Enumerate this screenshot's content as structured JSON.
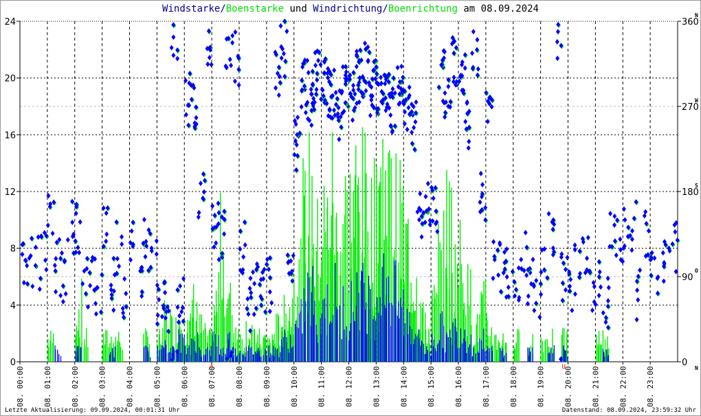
{
  "title": {
    "part1": "Windstarke/",
    "part2": "Boenstarke",
    "part3": " und ",
    "part4": "Windrichtung/",
    "part5": "Boenrichtung",
    "part6": " am 08.09.2024"
  },
  "footer": {
    "left": "Letzte Aktualisierung: 09.09.2024, 00:01:31 Uhr",
    "right": "Datenstand: 08.09.2024, 23:59:32 Uhr"
  },
  "colors": {
    "speed": "#0000ff",
    "gust": "#00ee00",
    "grid": "#000000",
    "dirgrid": "#bbbbbb",
    "marker": "#ff0000"
  },
  "chart_data": {
    "type": "line",
    "title": "Windstarke/Boenstarke und Windrichtung/Boenrichtung am 08.09.2024",
    "x_labels": [
      "08. 00:00",
      "08. 01:00",
      "08. 02:00",
      "08. 03:00",
      "08. 04:00",
      "08. 05:00",
      "08. 06:00",
      "08. 07:00",
      "08. 08:00",
      "08. 09:00",
      "08. 10:00",
      "08. 11:00",
      "08. 12:00",
      "08. 13:00",
      "08. 14:00",
      "08. 15:00",
      "08. 16:00",
      "08. 17:00",
      "08. 18:00",
      "08. 19:00",
      "08. 20:00",
      "08. 21:00",
      "08. 22:00",
      "08. 23:00"
    ],
    "left_axis": {
      "ylim": [
        0,
        24
      ],
      "ticks": [
        "0",
        "4",
        "8",
        "12",
        "16",
        "20",
        "24"
      ]
    },
    "right_axis": {
      "ylim": [
        0,
        360
      ],
      "ticks": [
        "0",
        "90",
        "180",
        "270",
        "360"
      ],
      "compass": [
        "N",
        "O",
        "S",
        "W",
        "N"
      ]
    },
    "markers": [
      {
        "hour": 7.0,
        "label": "A"
      },
      {
        "hour": 19.85,
        "label": "U"
      }
    ],
    "interval_minutes": 15,
    "series": [
      {
        "name": "Windstarke",
        "color": "#0000ff",
        "values": [
          0,
          0,
          0,
          0,
          0,
          1,
          0,
          0,
          1,
          0,
          0,
          0,
          0,
          1,
          0,
          0,
          0,
          0,
          1,
          0,
          1,
          2,
          1,
          2,
          1,
          2,
          1,
          1,
          2,
          1,
          2,
          1,
          1,
          1,
          1,
          1,
          1,
          1,
          2,
          2,
          3,
          5,
          6,
          4,
          5,
          6,
          4,
          5,
          5,
          7,
          6,
          5,
          6,
          8,
          6,
          5,
          4,
          3,
          2,
          1,
          2,
          3,
          2,
          3,
          3,
          2,
          1,
          2,
          1,
          0,
          1,
          0,
          0,
          0,
          1,
          0,
          0,
          1,
          0,
          1,
          0,
          0,
          0,
          0,
          0,
          1,
          0,
          0,
          0,
          0,
          0,
          0,
          0,
          0,
          0,
          0
        ]
      },
      {
        "name": "Boenstarke",
        "color": "#00ee00",
        "values": [
          0,
          0,
          0,
          0,
          2,
          0,
          0,
          0,
          5,
          2,
          0,
          0,
          2,
          2,
          2,
          0,
          0,
          0,
          2,
          0,
          2,
          4,
          3,
          4,
          3,
          5,
          3,
          2,
          5,
          10,
          5,
          3,
          2,
          3,
          2,
          2,
          2,
          3,
          4,
          5,
          8,
          12,
          14,
          10,
          12,
          15,
          11,
          13,
          13,
          15,
          14,
          12,
          17,
          15,
          13,
          12,
          10,
          8,
          5,
          3,
          5,
          9,
          12,
          8,
          9,
          6,
          3,
          5,
          3,
          2,
          2,
          0,
          2,
          0,
          2,
          0,
          2,
          2,
          0,
          2,
          0,
          0,
          0,
          0,
          2,
          2,
          0,
          0,
          0,
          0,
          0,
          0,
          0,
          0,
          0,
          0
        ]
      },
      {
        "name": "Windrichtung",
        "color": "#0000ff",
        "unit": "deg",
        "values": [
          108,
          108,
          105,
          110,
          150,
          100,
          90,
          140,
          140,
          85,
          85,
          80,
          150,
          80,
          120,
          75,
          120,
          80,
          125,
          120,
          70,
          60,
          350,
          70,
          280,
          270,
          170,
          330,
          150,
          130,
          340,
          320,
          120,
          60,
          80,
          70,
          80,
          300,
          330,
          100,
          230,
          290,
          280,
          300,
          300,
          280,
          260,
          290,
          280,
          300,
          310,
          290,
          290,
          280,
          270,
          300,
          270,
          250,
          150,
          160,
          160,
          300,
          270,
          320,
          300,
          250,
          330,
          170,
          280,
          110,
          100,
          90,
          80,
          120,
          90,
          70,
          100,
          130,
          345,
          90,
          80,
          100,
          120,
          80,
          80,
          60,
          140,
          130,
          140,
          140,
          70,
          130,
          95,
          100,
          110,
          125
        ]
      }
    ]
  }
}
